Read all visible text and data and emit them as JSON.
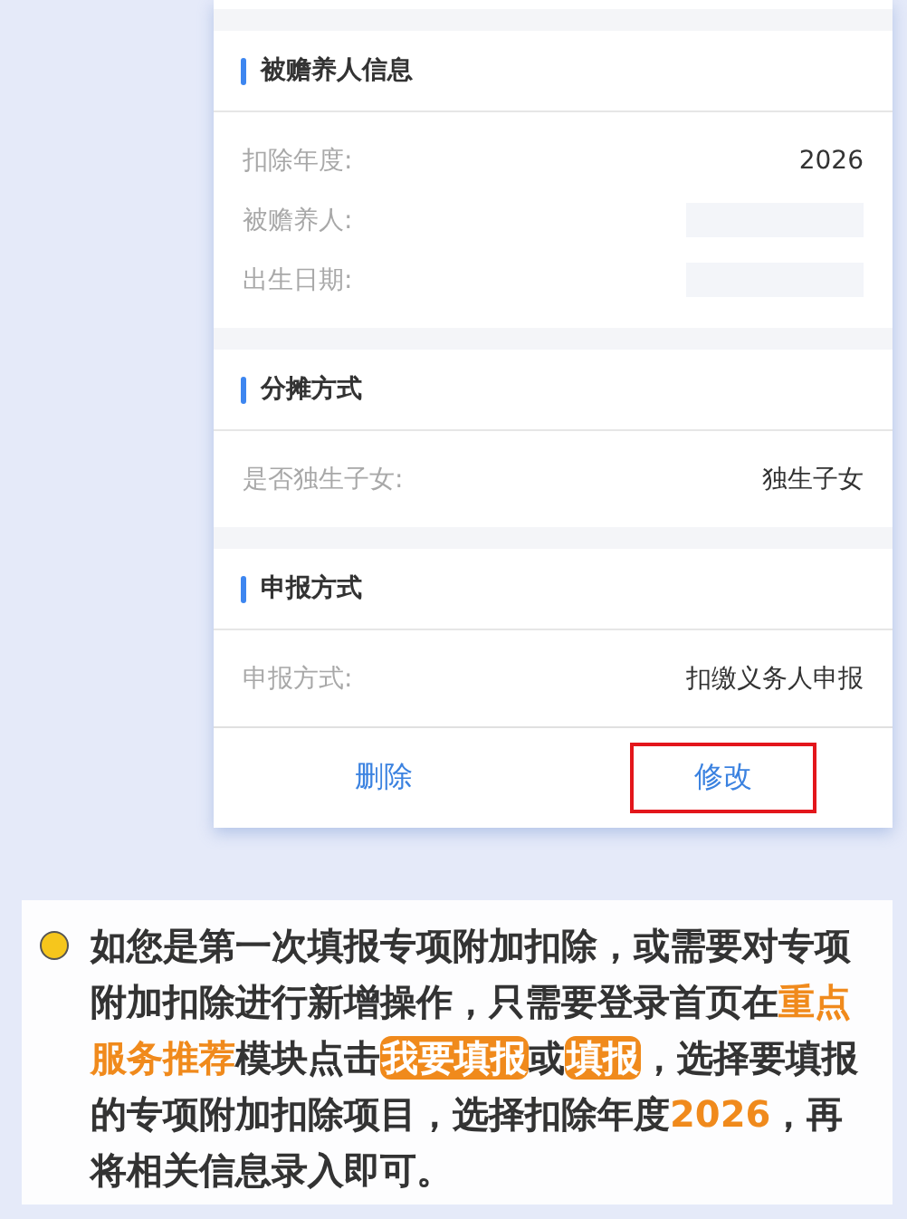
{
  "sections": [
    {
      "title": "被赡养人信息",
      "rows": [
        {
          "kind": "text",
          "label": "扣除年度:",
          "value": "2026"
        },
        {
          "kind": "masked",
          "label": "被赡养人:"
        },
        {
          "kind": "masked",
          "label": "出生日期:"
        }
      ]
    },
    {
      "title": "分摊方式",
      "rows": [
        {
          "kind": "text",
          "label": "是否独生子女:",
          "value": "独生子女"
        }
      ]
    },
    {
      "title": "申报方式",
      "rows": [
        {
          "kind": "text",
          "label": "申报方式:",
          "value": "扣缴义务人申报"
        }
      ]
    }
  ],
  "buttons": [
    {
      "label": "删除",
      "highlighted": false
    },
    {
      "label": "修改",
      "highlighted": true
    }
  ],
  "note": {
    "segments": [
      {
        "kind": "plain",
        "text": "如您是第一次填报专项附加扣除，或需要对专项附加扣除进行新增操作，只需要登录首页在"
      },
      {
        "kind": "highlight",
        "text": "重点服务推荐"
      },
      {
        "kind": "plain",
        "text": "模块点击"
      },
      {
        "kind": "pill",
        "text": "我要填报"
      },
      {
        "kind": "plain",
        "text": "或"
      },
      {
        "kind": "pill",
        "text": "填报"
      },
      {
        "kind": "plain",
        "text": "，选择要填报的专项附加扣除项目，选择扣除年度"
      },
      {
        "kind": "highlight",
        "text": "2026"
      },
      {
        "kind": "plain",
        "text": "，再将相关信息录入即可。"
      }
    ]
  }
}
